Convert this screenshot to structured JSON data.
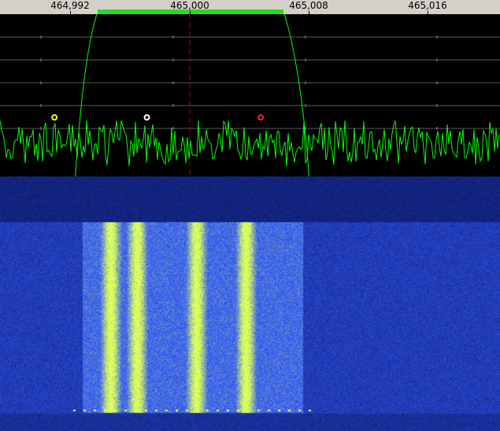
{
  "frequency_scale": {
    "labels": [
      "464,992",
      "465,000",
      "465,008",
      "465,016"
    ],
    "values_mhz": [
      464.992,
      465.0,
      465.008,
      465.016
    ],
    "range_mhz": [
      464.9895,
      465.0198
    ]
  },
  "filter": {
    "start_mhz": 464.9954,
    "end_mhz": 465.0067,
    "center_mhz": 465.0,
    "color": "#22dd22"
  },
  "markers": [
    {
      "name": "marker-yellow",
      "freq_mhz": 464.9928,
      "color": "#ffff00"
    },
    {
      "name": "marker-white",
      "freq_mhz": 464.9984,
      "color": "#ffffff"
    },
    {
      "name": "marker-red",
      "freq_mhz": 465.0053,
      "color": "#ff2020"
    }
  ],
  "colors": {
    "scale_background": "#d4d0c8",
    "spectrum_trace": "#00ff00",
    "grid": "#5a5a5a",
    "center_line": "#cc0000",
    "waterfall_low": "#0a1a6a",
    "waterfall_high": "#d8ff60"
  }
}
